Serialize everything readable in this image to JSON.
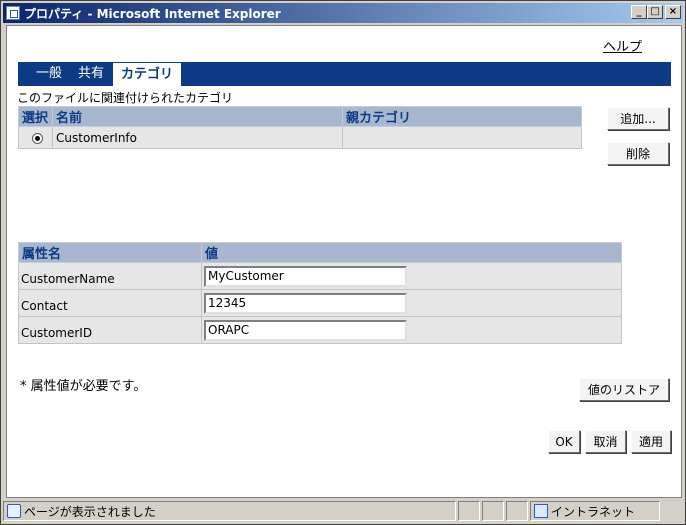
{
  "window": {
    "title": "プロパティ - Microsoft Internet Explorer",
    "minimize_glyph": "_",
    "maximize_glyph": "□",
    "close_glyph": "×"
  },
  "header": {
    "help_label": "ヘルプ"
  },
  "tabs": [
    {
      "label": "一般",
      "active": false
    },
    {
      "label": "共有",
      "active": false
    },
    {
      "label": "カテゴリ",
      "active": true
    }
  ],
  "category_section": {
    "caption": "このファイルに関連付けられたカテゴリ",
    "columns": {
      "select": "選択",
      "name": "名前",
      "parent": "親カテゴリ"
    },
    "rows": [
      {
        "selected": true,
        "name": "CustomerInfo",
        "parent": ""
      }
    ],
    "add_button": "追加...",
    "delete_button": "削除"
  },
  "attributes_section": {
    "columns": {
      "name": "属性名",
      "value": "値"
    },
    "rows": [
      {
        "name": "CustomerName",
        "value": "MyCustomer"
      },
      {
        "name": "Contact",
        "value": "12345"
      },
      {
        "name": "CustomerID",
        "value": "ORAPC"
      }
    ],
    "required_note": "* 属性値が必要です。",
    "restore_button": "値のリストア"
  },
  "footer_buttons": {
    "ok": "OK",
    "cancel": "取消",
    "apply": "適用"
  },
  "statusbar": {
    "message": "ページが表示されました",
    "zone": "イントラネット"
  },
  "colors": {
    "tab_bar": "#0d3a84",
    "table_header": "#a9b6cf",
    "table_header_text": "#0d3a84"
  }
}
